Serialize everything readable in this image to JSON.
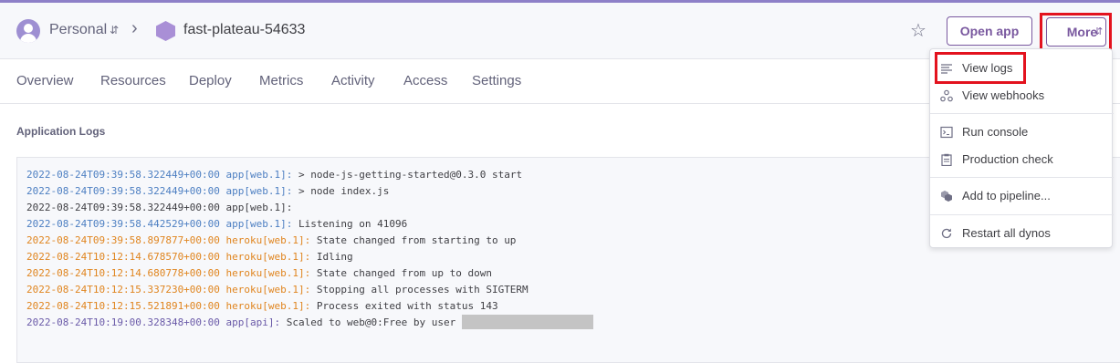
{
  "header": {
    "team": "Personal",
    "app_name": "fast-plateau-54633",
    "open_app_label": "Open app",
    "more_label": "More"
  },
  "tabs": [
    "Overview",
    "Resources",
    "Deploy",
    "Metrics",
    "Activity",
    "Access",
    "Settings"
  ],
  "section_title": "Application Logs",
  "logs": [
    {
      "ts": "2022-08-24T09:39:58.322449+00:00",
      "src": "app[web.1]:",
      "msg": " > node-js-getting-started@0.3.0 start",
      "style": "blue"
    },
    {
      "ts": "2022-08-24T09:39:58.322449+00:00",
      "src": "app[web.1]:",
      "msg": " > node index.js",
      "style": "blue"
    },
    {
      "ts": "2022-08-24T09:39:58.322449+00:00",
      "src": "app[web.1]:",
      "msg": "",
      "style": "dark"
    },
    {
      "ts": "2022-08-24T09:39:58.442529+00:00",
      "src": "app[web.1]:",
      "msg": " Listening on 41096",
      "style": "blue"
    },
    {
      "ts": "2022-08-24T09:39:58.897877+00:00",
      "src": "heroku[web.1]:",
      "msg": " State changed from starting to up",
      "style": "orange"
    },
    {
      "ts": "2022-08-24T10:12:14.678570+00:00",
      "src": "heroku[web.1]:",
      "msg": " Idling",
      "style": "orange"
    },
    {
      "ts": "2022-08-24T10:12:14.680778+00:00",
      "src": "heroku[web.1]:",
      "msg": " State changed from up to down",
      "style": "orange"
    },
    {
      "ts": "2022-08-24T10:12:15.337230+00:00",
      "src": "heroku[web.1]:",
      "msg": " Stopping all processes with SIGTERM",
      "style": "orange"
    },
    {
      "ts": "2022-08-24T10:12:15.521891+00:00",
      "src": "heroku[web.1]:",
      "msg": " Process exited with status 143",
      "style": "orange"
    },
    {
      "ts": "2022-08-24T10:19:00.328348+00:00",
      "src": "app[api]:",
      "msg": " Scaled to web@0:Free by user ",
      "style": "purple"
    }
  ],
  "menu": {
    "view_logs": "View logs",
    "view_webhooks": "View webhooks",
    "run_console": "Run console",
    "production_check": "Production check",
    "add_to_pipeline": "Add to pipeline...",
    "restart_all_dynos": "Restart all dynos"
  },
  "colors": {
    "brand": "#79589f",
    "highlight": "#e3121e",
    "log_app": "#4d7fc2",
    "log_heroku": "#e0851f",
    "log_api": "#6a5aa8"
  },
  "icons": {
    "avatar": "user-avatar-icon",
    "app": "hexagon-app-icon",
    "star": "star-icon",
    "logs": "lines-icon",
    "webhooks": "webhook-icon",
    "console": "terminal-icon",
    "check": "clipboard-icon",
    "pipeline": "pipeline-icon",
    "restart": "restart-icon"
  }
}
